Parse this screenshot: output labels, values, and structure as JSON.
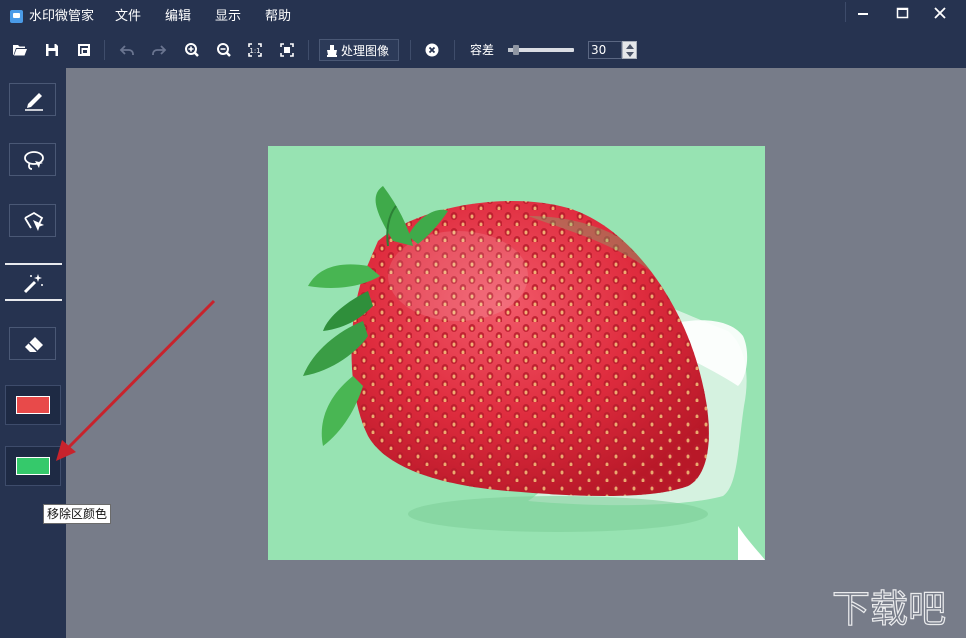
{
  "window": {
    "title": "水印微管家",
    "controls": {
      "minimize": "—",
      "maximize": "☐",
      "close": "✕"
    }
  },
  "menu": [
    "文件",
    "编辑",
    "显示",
    "帮助"
  ],
  "toolbar": {
    "icons": [
      "open-folder-icon",
      "save-icon",
      "save-as-icon",
      "undo-icon",
      "redo-icon",
      "zoom-in-icon",
      "zoom-out-icon",
      "actual-size-icon",
      "fit-window-icon",
      "clear-icon"
    ],
    "process_label": "处理图像",
    "tolerance_label": "容差",
    "tolerance_value": "30",
    "tolerance_slider_level": 0.08
  },
  "sidebar": {
    "tools": [
      "pen-tool-icon",
      "lasso-tool-icon",
      "polygon-lasso-icon",
      "magic-wand-icon",
      "eraser-icon"
    ],
    "selected_tool": "magic-wand-icon",
    "colors": {
      "keep_area_color": "#e84a4a",
      "remove_area_color": "#35c96b"
    }
  },
  "tooltip": "移除区颜色",
  "canvas": {
    "background": "#777c89",
    "image_background": "#97e3b2"
  },
  "watermark": "下载吧"
}
